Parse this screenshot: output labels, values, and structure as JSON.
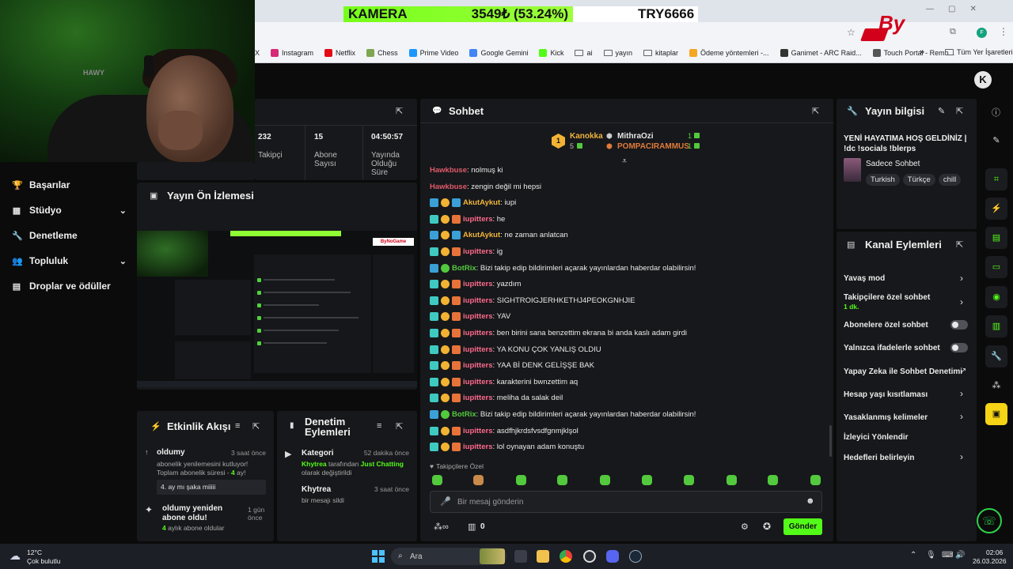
{
  "ticker": {
    "left": "KAMERA",
    "value": "3549₺ (53.24%)",
    "right": "TRY6666"
  },
  "bookmarks": [
    {
      "label": "X",
      "icon": "x-icon",
      "color": "#000000"
    },
    {
      "label": "Instagram",
      "icon": "instagram-icon",
      "color": "#d62976"
    },
    {
      "label": "Netflix",
      "icon": "netflix-icon",
      "color": "#e50914"
    },
    {
      "label": "Chess",
      "icon": "chess-icon",
      "color": "#7fa650"
    },
    {
      "label": "Prime Video",
      "icon": "prime-video-icon",
      "color": "#1a98ff"
    },
    {
      "label": "Google Gemini",
      "icon": "gemini-icon",
      "color": "#4285f4"
    },
    {
      "label": "Kick",
      "icon": "kick-icon",
      "color": "#53fc18"
    },
    {
      "label": "ai",
      "icon": "folder-icon",
      "color": ""
    },
    {
      "label": "yayın",
      "icon": "folder-icon",
      "color": ""
    },
    {
      "label": "kitaplar",
      "icon": "folder-icon",
      "color": ""
    },
    {
      "label": "Ödeme yöntemleri -...",
      "icon": "payment-icon",
      "color": "#f5a623"
    },
    {
      "label": "Ganimet - ARC Raid...",
      "icon": "arc-icon",
      "color": "#333333"
    },
    {
      "label": "Touch Portal - Remo...",
      "icon": "touch-portal-icon",
      "color": "#555555"
    }
  ],
  "bookmarks_more": "»",
  "all_bookmarks": "Tüm Yer İşaretleri",
  "cam_logo": "HAWY",
  "overlay_logo": "ByNoGame",
  "sidebar": {
    "items": [
      {
        "label": "Başarılar",
        "icon": "trophy-icon",
        "chevron": ""
      },
      {
        "label": "Stüdyo",
        "icon": "studio-icon",
        "chevron": "⌄"
      },
      {
        "label": "Denetleme",
        "icon": "wrench-icon",
        "chevron": ""
      },
      {
        "label": "Topluluk",
        "icon": "community-icon",
        "chevron": "⌄"
      },
      {
        "label": "Droplar ve ödüller",
        "icon": "drops-icon",
        "chevron": ""
      }
    ]
  },
  "stats": [
    {
      "value": "232",
      "label": "Takipçi"
    },
    {
      "value": "15",
      "label": "Abone Sayısı"
    },
    {
      "value": "04:50:57",
      "label": "Yayında Olduğu Süre"
    }
  ],
  "preview": {
    "title": "Yayın Ön İzlemesi"
  },
  "activity": {
    "title": "Etkinlik Akışı",
    "items": [
      {
        "user": "oldumy",
        "time": "3 saat önce",
        "line1": "abonelik yenilemesini kutluyor!",
        "line2_prefix": "Toplam abonelik süresi - ",
        "line2_num": "4",
        "line2_suffix": " ay!",
        "message": "4. ay mı şaka miiiii"
      },
      {
        "user": "oldumy yeniden abone oldu!",
        "time": "1 gün önce",
        "num": "4",
        "desc": " aylık abone oldular"
      }
    ]
  },
  "mod_actions": {
    "title": "Denetim Eylemleri",
    "items": [
      {
        "title": "Kategori",
        "time": "52 dakika önce",
        "actor": "Khytrea",
        "mid": " tarafından ",
        "target": "Just Chatting",
        "tail": "olarak değiştirildi"
      },
      {
        "title": "Khytrea",
        "time": "3 saat önce",
        "desc": "bir mesajı sildi"
      }
    ]
  },
  "chat": {
    "title": "Sohbet",
    "pinned": [
      {
        "name": "Kanokka",
        "count": "5"
      },
      {
        "name": "MithraOzi",
        "count": "1"
      },
      {
        "name": "POMPACIRAMMUS",
        "count": "1"
      }
    ],
    "messages": [
      {
        "user": "Hawkbuse",
        "color": "#e05a6a",
        "text": ": nolmuş ki",
        "badges": []
      },
      {
        "user": "Hawkbuse",
        "color": "#e05a6a",
        "text": ": zengin değil mi hepsi",
        "badges": []
      },
      {
        "user": "AkutAykut",
        "color": "#f0b43c",
        "text": ": iupi",
        "badges": [
          "blue",
          "gold",
          "blue"
        ]
      },
      {
        "user": "iupitters",
        "color": "#ff6a8d",
        "text": ": he",
        "badges": [
          "teal",
          "gold",
          "orange"
        ]
      },
      {
        "user": "AkutAykut",
        "color": "#f0b43c",
        "text": ": ne zaman anlatcan",
        "badges": [
          "blue",
          "gold",
          "blue"
        ]
      },
      {
        "user": "iupitters",
        "color": "#ff6a8d",
        "text": ": ig",
        "badges": [
          "teal",
          "gold",
          "orange"
        ]
      },
      {
        "user": "BotRix",
        "color": "#53c93e",
        "text": ": Bizi takip edip bildirimleri açarak yayınlardan haberdar olabilirsin!",
        "badges": [
          "blue",
          "green"
        ]
      },
      {
        "user": "iupitters",
        "color": "#ff6a8d",
        "text": ": yazdım",
        "badges": [
          "teal",
          "gold",
          "orange"
        ]
      },
      {
        "user": "iupitters",
        "color": "#ff6a8d",
        "text": ": SIGHTROIGJERHKETHJ4PEOKGNHJIE",
        "badges": [
          "teal",
          "gold",
          "orange"
        ]
      },
      {
        "user": "iupitters",
        "color": "#ff6a8d",
        "text": ": YAV",
        "badges": [
          "teal",
          "gold",
          "orange"
        ]
      },
      {
        "user": "iupitters",
        "color": "#ff6a8d",
        "text": ": ben birini sana benzettim ekrana bi anda kaslı adam girdi",
        "badges": [
          "teal",
          "gold",
          "orange"
        ]
      },
      {
        "user": "iupitters",
        "color": "#ff6a8d",
        "text": ": YA KONU ÇOK YANLIŞ OLDIU",
        "badges": [
          "teal",
          "gold",
          "orange"
        ]
      },
      {
        "user": "iupitters",
        "color": "#ff6a8d",
        "text": ": YAA Bİ DENK GELİŞŞE BAK",
        "badges": [
          "teal",
          "gold",
          "orange"
        ]
      },
      {
        "user": "iupitters",
        "color": "#ff6a8d",
        "text": ": karakterini bwnzettim aq",
        "badges": [
          "teal",
          "gold",
          "orange"
        ]
      },
      {
        "user": "iupitters",
        "color": "#ff6a8d",
        "text": ": meliha da salak deil",
        "badges": [
          "teal",
          "gold",
          "orange"
        ]
      },
      {
        "user": "BotRix",
        "color": "#53c93e",
        "text": ": Bizi takip edip bildirimleri açarak yayınlardan haberdar olabilirsin!",
        "badges": [
          "blue",
          "green"
        ]
      },
      {
        "user": "iupitters",
        "color": "#ff6a8d",
        "text": ": asdfhjkrdsfvsdfgnmjklşol",
        "badges": [
          "teal",
          "gold",
          "orange"
        ]
      },
      {
        "user": "iupitters",
        "color": "#ff6a8d",
        "text": ": lol oynayan adam konuştu",
        "badges": [
          "teal",
          "gold",
          "orange"
        ]
      }
    ],
    "followers_only": "Takipçilere Özel",
    "input_placeholder": "Bir mesaj gönderin",
    "points": "0",
    "send_label": "Gönder"
  },
  "stream_info": {
    "title": "Yayın bilgisi",
    "stream_title": "YENİ HAYATIMA HOŞ GELDİNİZ | !dc !socials !blerps",
    "category": "Sadece Sohbet",
    "tags": [
      "Turkish",
      "Türkçe",
      "chill"
    ]
  },
  "channel_actions": {
    "title": "Kanal Eylemleri",
    "rows": [
      {
        "label": "Yavaş mod",
        "sub": "",
        "control": "chevron"
      },
      {
        "label": "Takipçilere özel sohbet",
        "sub": "1 dk.",
        "control": "chevron"
      },
      {
        "label": "Abonelere özel sohbet",
        "sub": "",
        "control": "toggle"
      },
      {
        "label": "Yalnızca ifadelerle sohbet",
        "sub": "",
        "control": "toggle"
      },
      {
        "label": "Yapay Zeka ile Sohbet Denetimi",
        "sub": "",
        "control": "external"
      },
      {
        "label": "Hesap yaşı kısıtlaması",
        "sub": "",
        "control": "chevron"
      },
      {
        "label": "Yasaklanmış kelimeler",
        "sub": "",
        "control": "chevron"
      },
      {
        "label": "İzleyici Yönlendir",
        "sub": "",
        "control": "none"
      },
      {
        "label": "Hedefleri belirleyin",
        "sub": "",
        "control": "chevron"
      }
    ]
  },
  "taskbar": {
    "weather_temp": "12°C",
    "weather_desc": "Çok bulutlu",
    "search": "Ara",
    "time": "02:06",
    "date": "26.03.2026"
  }
}
